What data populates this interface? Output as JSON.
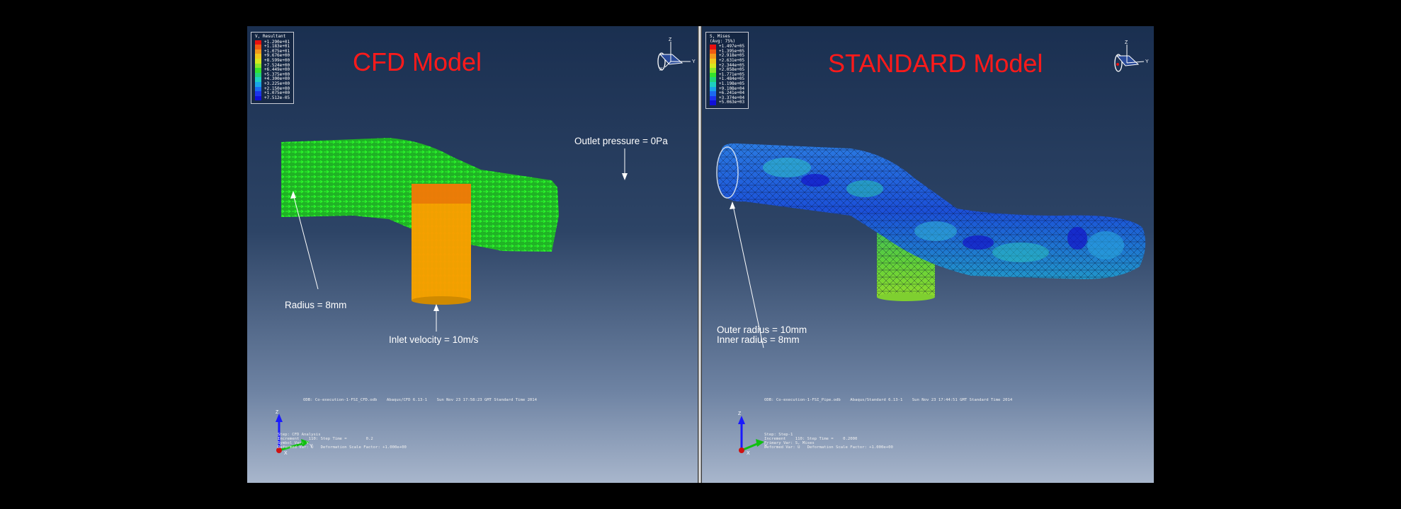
{
  "left": {
    "title": "CFD Model",
    "legend": {
      "title": "V, Resultant",
      "values": [
        "+1.290e+01",
        "+1.183e+01",
        "+1.075e+01",
        "+9.676e+00",
        "+8.599e+00",
        "+7.524e+00",
        "+6.449e+00",
        "+5.375e+00",
        "+4.300e+00",
        "+3.225e+00",
        "+2.150e+00",
        "+1.075e+00",
        "+7.512e-05"
      ],
      "colors": [
        "#e81010",
        "#f05a12",
        "#f2981a",
        "#f0c81c",
        "#d6e81e",
        "#8ce82a",
        "#34e22c",
        "#22d478",
        "#1ed0c0",
        "#1aa4e8",
        "#1c6af0",
        "#1c34ec",
        "#1010d8"
      ]
    },
    "annotations": {
      "radius": "Radius = 8mm",
      "inlet": "Inlet velocity = 10m/s",
      "outlet": "Outlet pressure = 0Pa"
    },
    "info": {
      "odb": "ODB: Co-execution-1-FSI_CFD.odb    Abaqus/CFD 6.13-1    Sun Nov 23 17:58:23 GMT Standard Time 2014",
      "step": "Step: CFD Analysis",
      "increment": "Increment    110: Step Time =        0.2",
      "primary": "Symbol Var: V",
      "deformed": "Deformed Var: U   Deformation Scale Factor: +1.000e+00"
    }
  },
  "right": {
    "title": "STANDARD Model",
    "legend": {
      "title": "S, Mises\n(Avg: 75%)",
      "values": [
        "+1.497e+05",
        "+1.395e+05",
        "+2.918e+05",
        "+2.631e+05",
        "+2.344e+05",
        "+2.058e+05",
        "+1.771e+05",
        "+1.484e+05",
        "+1.198e+05",
        "+9.108e+04",
        "+6.241e+04",
        "+3.374e+04",
        "+5.063e+03"
      ],
      "colors": [
        "#e81010",
        "#f05a12",
        "#f2981a",
        "#f0c81c",
        "#d6e81e",
        "#8ce82a",
        "#34e22c",
        "#22d478",
        "#1ed0c0",
        "#1aa4e8",
        "#1c6af0",
        "#1c34ec",
        "#1010d8"
      ]
    },
    "annotations": {
      "outer": "Outer radius = 10mm",
      "inner": "Inner radius = 8mm"
    },
    "info": {
      "odb": "ODB: Co-execution-1-FSI_Pipe.odb    Abaqus/Standard 6.13-1    Sun Nov 23 17:44:51 GMT Standard Time 2014",
      "step": "Step: Step-1",
      "increment": "Increment    110: Step Time =    0.2000",
      "primary": "Primary Var: S, Mises",
      "deformed": "Deformed Var: U   Deformation Scale Factor: +1.000e+00"
    }
  },
  "triad": {
    "x": "X",
    "y": "Y",
    "z": "Z"
  }
}
